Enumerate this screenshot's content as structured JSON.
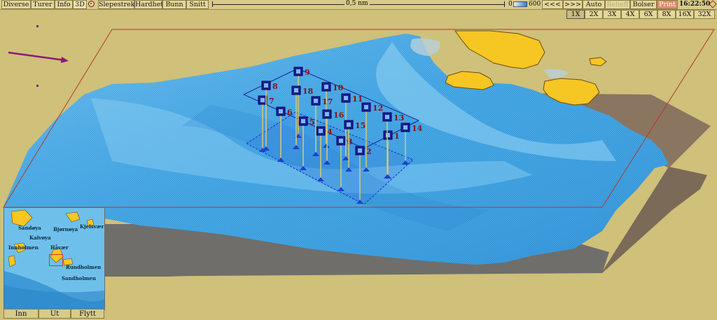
{
  "toolbar": {
    "menu": [
      "Diverse",
      "Turer",
      "Info",
      "3D"
    ],
    "items_right": [
      "Slepestrek",
      "Hardhet",
      "Bunn",
      "Snitt"
    ],
    "scale_label": "0,5 nm",
    "depth_min": "0",
    "depth_max": "600",
    "nav_back": "<<<",
    "nav_forward": ">>>",
    "auto": "Auto",
    "relieff": "Relieff",
    "bolser": "Bolser",
    "print": "Print",
    "time": "16:22:50"
  },
  "zoom": {
    "levels": [
      "1X",
      "2X",
      "3X",
      "4X",
      "6X",
      "8X",
      "16X",
      "32X"
    ],
    "selected": "1X"
  },
  "view": {
    "markers": [
      "1",
      "2",
      "3",
      "4",
      "5",
      "6",
      "7",
      "8",
      "9",
      "10",
      "11",
      "12",
      "13",
      "14",
      "15",
      "16",
      "17",
      "18"
    ]
  },
  "minimap": {
    "labels": [
      "Sandøya",
      "Bjørnøya",
      "Kjelsvær",
      "Innholmen",
      "Håvær",
      "Rundholmen",
      "Kalvøya",
      "Sandholmen"
    ],
    "buttons": [
      "Inn",
      "Ut",
      "Flytt"
    ]
  },
  "colors": {
    "background": "#cfc07a",
    "terrain": "#46a8e6",
    "markers": "#1b1f9a",
    "labels": "#8a1010",
    "islands": "#f6c623"
  }
}
